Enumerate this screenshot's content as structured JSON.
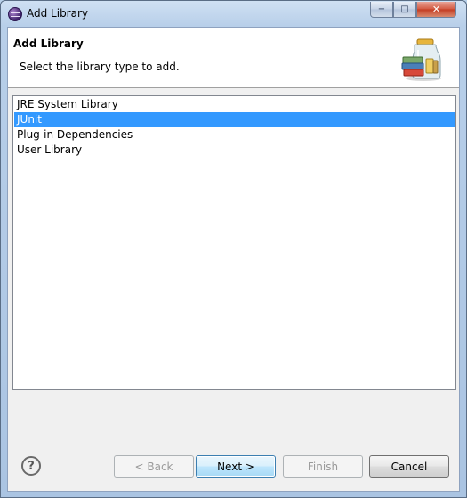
{
  "window": {
    "title": "Add Library",
    "minimize_label": "−",
    "maximize_label": "□",
    "close_label": "✕"
  },
  "header": {
    "title": "Add Library",
    "description": "Select the library type to add."
  },
  "library_types": {
    "items": [
      {
        "label": "JRE System Library",
        "selected": false
      },
      {
        "label": "JUnit",
        "selected": true
      },
      {
        "label": "Plug-in Dependencies",
        "selected": false
      },
      {
        "label": "User Library",
        "selected": false
      }
    ]
  },
  "footer": {
    "help_label": "?",
    "back_label": "< Back",
    "next_label": "Next >",
    "finish_label": "Finish",
    "cancel_label": "Cancel"
  },
  "colors": {
    "selection": "#3399ff",
    "titlebar": "#b8cfe9",
    "dialog_bg": "#f0f0f0"
  },
  "icons": {
    "app": "eclipse-icon",
    "header": "library-jar-icon",
    "help": "help-icon"
  }
}
